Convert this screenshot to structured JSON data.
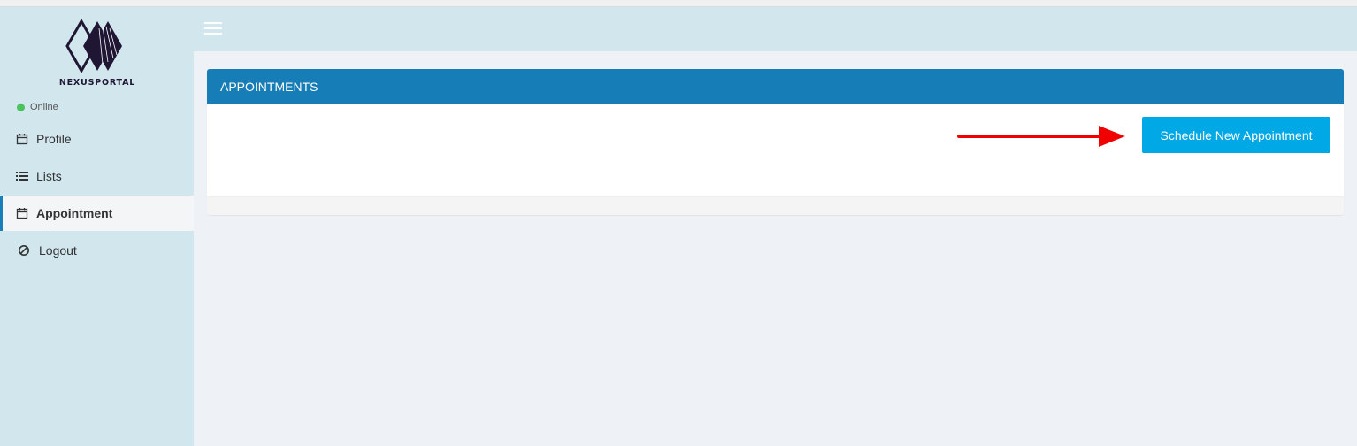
{
  "brand": {
    "name": "NEXUSPORTAL"
  },
  "status": {
    "label": "Online",
    "color": "#4cc25d"
  },
  "sidebar": {
    "items": [
      {
        "label": "Profile",
        "icon": "calendar-icon",
        "active": false
      },
      {
        "label": "Lists",
        "icon": "list-icon",
        "active": false
      },
      {
        "label": "Appointment",
        "icon": "calendar-icon",
        "active": true
      },
      {
        "label": "Logout",
        "icon": "ban-icon",
        "active": false
      }
    ]
  },
  "panel": {
    "title": "APPOINTMENTS",
    "schedule_button_label": "Schedule New Appointment"
  },
  "colors": {
    "sidebar_bg": "#d2e6ee",
    "header_bg": "#167db6",
    "button_bg": "#00a8e6",
    "annotation_arrow": "#f00000"
  }
}
